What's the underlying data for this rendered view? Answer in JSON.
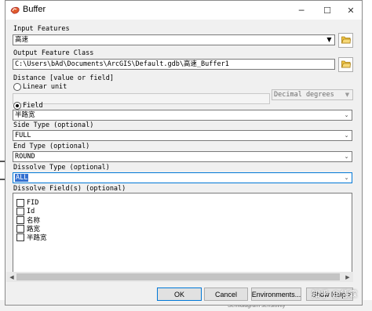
{
  "window": {
    "title": "Buffer"
  },
  "input_features": {
    "label": "Input Features",
    "value": "高速"
  },
  "output_feature_class": {
    "label": "Output Feature Class",
    "value": "C:\\Users\\bAd\\Documents\\ArcGIS\\Default.gdb\\高速_Buffer1"
  },
  "distance": {
    "label": "Distance [value or field]",
    "linear_unit_label": "Linear unit",
    "unit_value": "Decimal degrees",
    "field_label": "Field",
    "field_value": "半路宽",
    "selected_option": "Field"
  },
  "side_type": {
    "label": "Side Type (optional)",
    "value": "FULL"
  },
  "end_type": {
    "label": "End Type (optional)",
    "value": "ROUND"
  },
  "dissolve_type": {
    "label": "Dissolve Type (optional)",
    "value": "ALL"
  },
  "dissolve_fields": {
    "label": "Dissolve Field(s) (optional)",
    "items": [
      {
        "label": "FID",
        "checked": false
      },
      {
        "label": "Id",
        "checked": false
      },
      {
        "label": "名称",
        "checked": false
      },
      {
        "label": "路宽",
        "checked": false
      },
      {
        "label": "半路宽",
        "checked": false
      }
    ]
  },
  "buttons": {
    "ok": "OK",
    "cancel": "Cancel",
    "environments": "Environments...",
    "show_help": "Show Help >>"
  },
  "watermark": "知乎 @恁霖",
  "background_caption": "Semidiagram sensitivity",
  "colors": {
    "selection": "#3370d0",
    "focus_border": "#0078d7",
    "window_bg": "#f0f0f0"
  },
  "icons": {
    "app": "buffer-tool-icon",
    "folder": "open-folder-icon",
    "dropdown": "chevron-down-icon"
  }
}
